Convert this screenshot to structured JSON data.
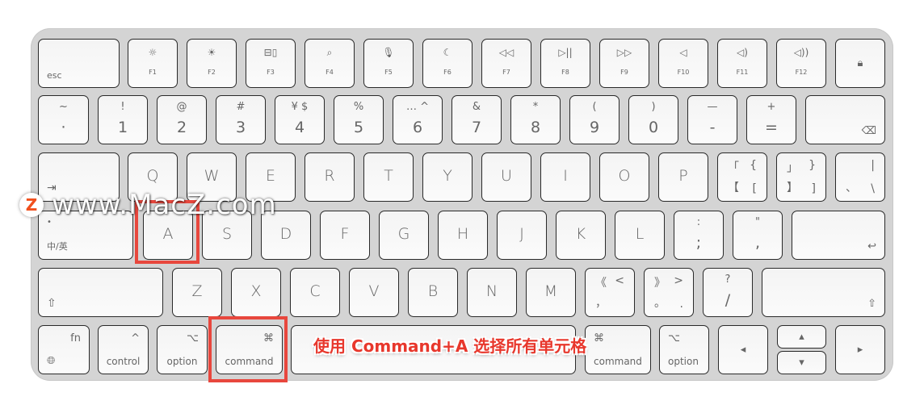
{
  "keyboard": {
    "rows": [
      [
        {
          "name": "esc",
          "label": "esc",
          "style": "mod"
        },
        {
          "name": "f1",
          "icon": "☼",
          "label": "F1",
          "style": "fn",
          "icon_name": "brightness-down-icon"
        },
        {
          "name": "f2",
          "icon": "☀",
          "label": "F2",
          "style": "fn",
          "icon_name": "brightness-up-icon"
        },
        {
          "name": "f3",
          "icon": "⊟▯",
          "label": "F3",
          "style": "fn",
          "icon_name": "mission-control-icon"
        },
        {
          "name": "f4",
          "icon": "⌕",
          "label": "F4",
          "style": "fn",
          "icon_name": "search-icon"
        },
        {
          "name": "f5",
          "icon": "🎙",
          "label": "F5",
          "style": "fn",
          "icon_name": "microphone-icon"
        },
        {
          "name": "f6",
          "icon": "☾",
          "label": "F6",
          "style": "fn",
          "icon_name": "moon-icon"
        },
        {
          "name": "f7",
          "icon": "◁◁",
          "label": "F7",
          "style": "fn",
          "icon_name": "rewind-icon"
        },
        {
          "name": "f8",
          "icon": "▷||",
          "label": "F8",
          "style": "fn",
          "icon_name": "play-pause-icon"
        },
        {
          "name": "f9",
          "icon": "▷▷",
          "label": "F9",
          "style": "fn",
          "icon_name": "fast-forward-icon"
        },
        {
          "name": "f10",
          "icon": "◁",
          "label": "F10",
          "style": "fn",
          "icon_name": "mute-icon"
        },
        {
          "name": "f11",
          "icon": "◁)",
          "label": "F11",
          "style": "fn",
          "icon_name": "volume-down-icon"
        },
        {
          "name": "f12",
          "icon": "◁))",
          "label": "F12",
          "style": "fn",
          "icon_name": "volume-up-icon"
        },
        {
          "name": "lock",
          "icon": "🔒︎",
          "style": "center-icon",
          "icon_name": "lock-icon"
        }
      ],
      [
        {
          "name": "tilde",
          "top": "~",
          "main": "·",
          "style": "num"
        },
        {
          "name": "1",
          "top": "!",
          "main": "1",
          "style": "num"
        },
        {
          "name": "2",
          "top": "@",
          "main": "2",
          "style": "num"
        },
        {
          "name": "3",
          "top": "#",
          "main": "3",
          "style": "num"
        },
        {
          "name": "4",
          "top": "¥   $",
          "main": "4",
          "style": "num"
        },
        {
          "name": "5",
          "top": "%",
          "main": "5",
          "style": "num"
        },
        {
          "name": "6",
          "top": "…   ^",
          "main": "6",
          "style": "num"
        },
        {
          "name": "7",
          "top": "&",
          "main": "7",
          "style": "num"
        },
        {
          "name": "8",
          "top": "*",
          "main": "8",
          "style": "num"
        },
        {
          "name": "9",
          "top": "(",
          "main": "9",
          "style": "num"
        },
        {
          "name": "0",
          "top": ")",
          "main": "0",
          "style": "num"
        },
        {
          "name": "minus",
          "top": "—",
          "main": "-",
          "style": "num"
        },
        {
          "name": "equals",
          "top": "+",
          "main": "=",
          "style": "num"
        },
        {
          "name": "delete",
          "icon": "⌫",
          "style": "br-icon",
          "icon_name": "delete-icon"
        }
      ],
      [
        {
          "name": "tab",
          "icon": "⇥",
          "style": "bl-icon",
          "icon_name": "tab-icon"
        },
        {
          "name": "q",
          "main": "Q",
          "style": "letter"
        },
        {
          "name": "w",
          "main": "W",
          "style": "letter"
        },
        {
          "name": "e",
          "main": "E",
          "style": "letter"
        },
        {
          "name": "r",
          "main": "R",
          "style": "letter"
        },
        {
          "name": "t",
          "main": "T",
          "style": "letter"
        },
        {
          "name": "y",
          "main": "Y",
          "style": "letter"
        },
        {
          "name": "u",
          "main": "U",
          "style": "letter"
        },
        {
          "name": "i",
          "main": "I",
          "style": "letter"
        },
        {
          "name": "o",
          "main": "O",
          "style": "letter"
        },
        {
          "name": "p",
          "main": "P",
          "style": "letter"
        },
        {
          "name": "left-bracket",
          "q": [
            "「",
            "{",
            "【",
            "["
          ],
          "style": "quad"
        },
        {
          "name": "right-bracket",
          "q": [
            "」",
            "}",
            "】",
            "]"
          ],
          "style": "quad"
        },
        {
          "name": "backslash",
          "q": [
            "",
            "|",
            "、",
            "\\"
          ],
          "style": "quad"
        }
      ],
      [
        {
          "name": "caps-lock",
          "top": "•",
          "label": "中/英",
          "style": "mod"
        },
        {
          "name": "a",
          "main": "A",
          "style": "letter"
        },
        {
          "name": "s",
          "main": "S",
          "style": "letter"
        },
        {
          "name": "d",
          "main": "D",
          "style": "letter"
        },
        {
          "name": "f",
          "main": "F",
          "style": "letter"
        },
        {
          "name": "g",
          "main": "G",
          "style": "letter"
        },
        {
          "name": "h",
          "main": "H",
          "style": "letter"
        },
        {
          "name": "j",
          "main": "J",
          "style": "letter"
        },
        {
          "name": "k",
          "main": "K",
          "style": "letter"
        },
        {
          "name": "l",
          "main": "L",
          "style": "letter"
        },
        {
          "name": "semicolon",
          "top": ":",
          "main": ";",
          "style": "num"
        },
        {
          "name": "quote",
          "top": "\"",
          "main": ",",
          "style": "num"
        },
        {
          "name": "return",
          "icon": "↩",
          "style": "br-icon",
          "icon_name": "return-icon"
        }
      ],
      [
        {
          "name": "shift-left",
          "icon": "⇧",
          "style": "bl-icon",
          "icon_name": "shift-icon"
        },
        {
          "name": "z",
          "main": "Z",
          "style": "letter"
        },
        {
          "name": "x",
          "main": "X",
          "style": "letter"
        },
        {
          "name": "c",
          "main": "C",
          "style": "letter"
        },
        {
          "name": "v",
          "main": "V",
          "style": "letter"
        },
        {
          "name": "b",
          "main": "B",
          "style": "letter"
        },
        {
          "name": "n",
          "main": "N",
          "style": "letter"
        },
        {
          "name": "m",
          "main": "M",
          "style": "letter"
        },
        {
          "name": "comma",
          "q": [
            "《",
            "<",
            "，",
            ""
          ],
          "style": "quad"
        },
        {
          "name": "period",
          "q": [
            "》",
            ">",
            "。",
            "."
          ],
          "style": "quad"
        },
        {
          "name": "slash",
          "top": "?",
          "main": "/",
          "style": "num"
        },
        {
          "name": "shift-right",
          "icon": "⇧",
          "style": "br-icon",
          "icon_name": "shift-icon"
        }
      ],
      [
        {
          "name": "fn",
          "top": "fn",
          "icon": "🌐︎",
          "style": "fnkey",
          "icon_name": "globe-icon"
        },
        {
          "name": "control-left",
          "icon": "^",
          "label": "control",
          "style": "mod-icon",
          "icon_name": "control-icon"
        },
        {
          "name": "option-left",
          "icon": "⌥",
          "label": "option",
          "style": "mod-icon",
          "icon_name": "option-icon"
        },
        {
          "name": "command-left",
          "icon": "⌘",
          "label": "command",
          "style": "mod-icon",
          "icon_name": "command-icon"
        },
        {
          "name": "space",
          "style": "blank"
        },
        {
          "name": "command-right",
          "icon": "⌘",
          "label": "command",
          "style": "mod-icon-l",
          "icon_name": "command-icon"
        },
        {
          "name": "option-right",
          "icon": "⌥",
          "label": "option",
          "style": "mod-icon-l",
          "icon_name": "option-icon"
        },
        {
          "name": "arrow-left",
          "icon": "◂",
          "style": "center-icon",
          "icon_name": "arrow-left-icon"
        },
        {
          "name": "arrow-up",
          "icon": "▴",
          "style": "center-icon",
          "icon_name": "arrow-up-icon"
        },
        {
          "name": "arrow-down",
          "icon": "▾",
          "style": "center-icon",
          "icon_name": "arrow-down-icon"
        },
        {
          "name": "arrow-right",
          "icon": "▸",
          "style": "center-icon",
          "icon_name": "arrow-right-icon"
        }
      ]
    ]
  },
  "annotation": "使用 Command+A 选择所有单元格",
  "highlight_color": "#e8473d",
  "watermark": {
    "logo": "Z",
    "text": "www.MacZ.com"
  }
}
